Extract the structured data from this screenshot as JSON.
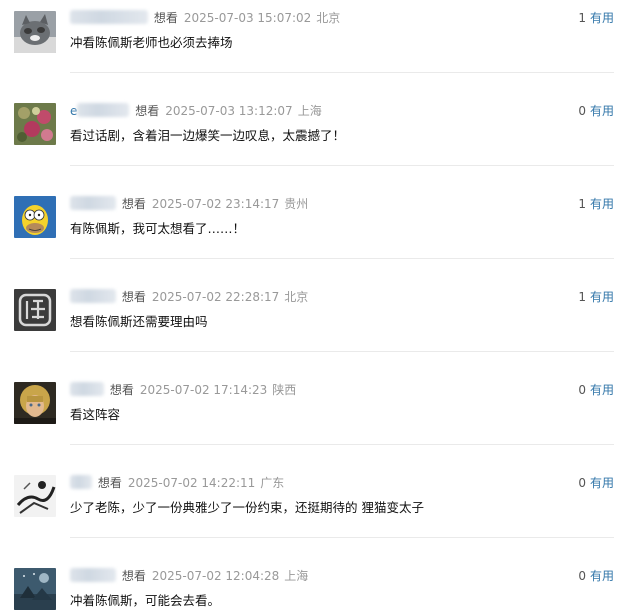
{
  "comments": [
    {
      "user_visible": "",
      "rating": "想看",
      "time": "2025-07-03 15:07:02",
      "location": "北京",
      "content": "冲看陈佩斯老师也必须去捧场",
      "votes": "1",
      "useful_label": "有用",
      "avatar_icon": "cat-avatar-icon"
    },
    {
      "user_visible": "e",
      "rating": "想看",
      "time": "2025-07-03 13:12:07",
      "location": "上海",
      "content": "看过话剧，含着泪一边爆笑一边叹息，太震撼了！",
      "votes": "0",
      "useful_label": "有用",
      "avatar_icon": "flowers-avatar-icon"
    },
    {
      "user_visible": "",
      "rating": "想看",
      "time": "2025-07-02 23:14:17",
      "location": "贵州",
      "content": "有陈佩斯，我可太想看了……！",
      "votes": "1",
      "useful_label": "有用",
      "avatar_icon": "homer-avatar-icon"
    },
    {
      "user_visible": "",
      "rating": "想看",
      "time": "2025-07-02 22:28:17",
      "location": "北京",
      "content": "想看陈佩斯还需要理由吗",
      "votes": "1",
      "useful_label": "有用",
      "avatar_icon": "stamp-avatar-icon"
    },
    {
      "user_visible": "",
      "rating": "想看",
      "time": "2025-07-02 17:14:23",
      "location": "陕西",
      "content": "看这阵容",
      "votes": "0",
      "useful_label": "有用",
      "avatar_icon": "portrait-avatar-icon"
    },
    {
      "user_visible": "",
      "rating": "想看",
      "time": "2025-07-02 14:22:11",
      "location": "广东",
      "content": "少了老陈，少了一份典雅少了一份约束，还挺期待的 狸猫变太子",
      "votes": "0",
      "useful_label": "有用",
      "avatar_icon": "sketch-avatar-icon"
    },
    {
      "user_visible": "",
      "rating": "想看",
      "time": "2025-07-02 12:04:28",
      "location": "上海",
      "content": "冲着陈佩斯，可能会去看。",
      "votes": "0",
      "useful_label": "有用",
      "avatar_icon": "night-avatar-icon"
    }
  ]
}
